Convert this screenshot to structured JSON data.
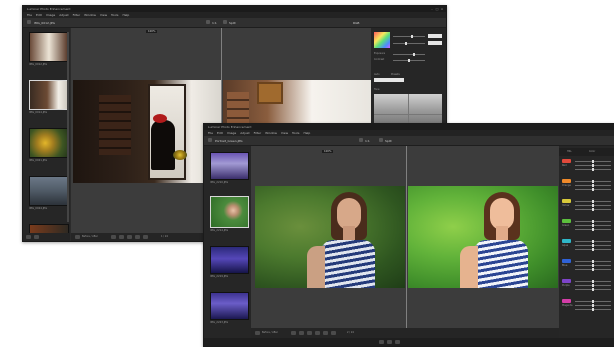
{
  "back_window": {
    "title": "Luminar Photo Enhancement",
    "menu": [
      "File",
      "Edit",
      "Image",
      "Adjust",
      "Filter",
      "Window",
      "View",
      "Tools",
      "Help"
    ],
    "toolbar": {
      "filename": "IMG_0012.JPG",
      "zoom": "1:1",
      "view_toggle": "Split",
      "info": "RGB"
    },
    "zoom_badge": "100%",
    "thumbs": [
      {
        "caption": "IMG_0012.JPG"
      },
      {
        "caption": "IMG_0014.JPG"
      },
      {
        "caption": "IMG_0021.JPG"
      },
      {
        "caption": "IMG_0024.JPG"
      },
      {
        "caption": "IMG_0027.JPG"
      }
    ],
    "right_panel": {
      "rows": [
        "Temperature",
        "Tint",
        "Exposure",
        "Contrast"
      ],
      "tabs": [
        "Auto",
        "Presets"
      ],
      "section": "Tone"
    },
    "bottom": {
      "mode": "Before / After",
      "page": "1 / 24"
    }
  },
  "front_window": {
    "title": "Luminar Photo Enhancement",
    "menu": [
      "File",
      "Edit",
      "Image",
      "Adjust",
      "Filter",
      "Window",
      "View",
      "Tools",
      "Help"
    ],
    "toolbar": {
      "filename": "Portrait_Green.JPG",
      "zoom": "1:1",
      "view_toggle": "Split",
      "info": "RGB"
    },
    "zoom_badge": "100%",
    "thumbs": [
      {
        "caption": "IMG_2210.JPG"
      },
      {
        "caption": "IMG_2214.JPG"
      },
      {
        "caption": "IMG_2219.JPG"
      },
      {
        "caption": "IMG_2223.JPG"
      },
      {
        "caption": "IMG_2230.JPG"
      }
    ],
    "right_panel": {
      "tabs": [
        "HSL",
        "Color"
      ],
      "colors": [
        {
          "name": "Red",
          "hex": "#e24a3b"
        },
        {
          "name": "Orange",
          "hex": "#ef8a2a"
        },
        {
          "name": "Yellow",
          "hex": "#d8c93a"
        },
        {
          "name": "Green",
          "hex": "#5cbf3d"
        },
        {
          "name": "Aqua",
          "hex": "#2fb7c9"
        },
        {
          "name": "Blue",
          "hex": "#2f62d8"
        },
        {
          "name": "Purple",
          "hex": "#7d44c9"
        },
        {
          "name": "Magenta",
          "hex": "#d43da8"
        }
      ]
    },
    "bottom": {
      "mode": "Before / After",
      "page": "2 / 24"
    }
  }
}
